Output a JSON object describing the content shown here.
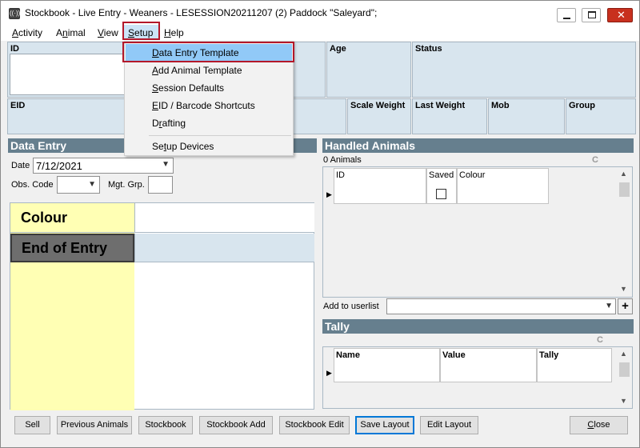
{
  "window": {
    "title": "Stockbook - Live Entry - Weaners - LESESSION20211207 (2) Paddock \"Saleyard\";"
  },
  "menu": {
    "activity": {
      "pre": "",
      "acc": "A",
      "post": "ctivity"
    },
    "animal": {
      "pre": "A",
      "acc": "n",
      "post": "imal"
    },
    "view": {
      "pre": "",
      "acc": "V",
      "post": "iew"
    },
    "setup": {
      "pre": "",
      "acc": "S",
      "post": "etup"
    },
    "help": {
      "pre": "",
      "acc": "H",
      "post": "elp"
    }
  },
  "setup_menu": {
    "items": [
      {
        "pre": "",
        "acc": "D",
        "post": "ata Entry Template"
      },
      {
        "pre": "",
        "acc": "A",
        "post": "dd Animal Template"
      },
      {
        "pre": "",
        "acc": "S",
        "post": "ession Defaults"
      },
      {
        "pre": "",
        "acc": "E",
        "post": "ID / Barcode Shortcuts"
      },
      {
        "pre": "D",
        "acc": "r",
        "post": "afting"
      },
      {
        "pre": "Se",
        "acc": "t",
        "post": "up Devices"
      }
    ]
  },
  "header_fields": {
    "id": "ID",
    "age": "Age",
    "status": "Status",
    "eid": "EID",
    "scale_weight": "Scale Weight",
    "last_weight": "Last Weight",
    "mob": "Mob",
    "group": "Group"
  },
  "data_entry": {
    "title": "Data Entry",
    "date_label": "Date",
    "date_value": "7/12/2021",
    "obs_code_label": "Obs. Code",
    "mgt_grp_label": "Mgt. Grp.",
    "rows": [
      {
        "label": "Colour"
      },
      {
        "label": "End of Entry"
      }
    ]
  },
  "handled_animals": {
    "title": "Handled Animals",
    "count": "0 Animals",
    "corner": "C",
    "columns": [
      "ID",
      "Saved",
      "Colour"
    ],
    "add_to_userlist_label": "Add to userlist",
    "add_button": "+"
  },
  "tally": {
    "title": "Tally",
    "corner": "C",
    "columns": [
      "Name",
      "Value",
      "Tally"
    ]
  },
  "buttons": {
    "sell": "Sell",
    "previous_animals": "Previous Animals",
    "stockbook": "Stockbook",
    "stockbook_add": "Stockbook Add",
    "stockbook_edit": "Stockbook Edit",
    "save_layout": "Save Layout",
    "edit_layout": "Edit Layout",
    "close": {
      "pre": "",
      "acc": "C",
      "post": "lose"
    }
  },
  "colors": {
    "section_header": "#667f8e",
    "panel": "#d8e5ee",
    "highlight": "#91c9f7",
    "annotation": "#b3182a",
    "entry_yellow": "#ffffb4"
  }
}
